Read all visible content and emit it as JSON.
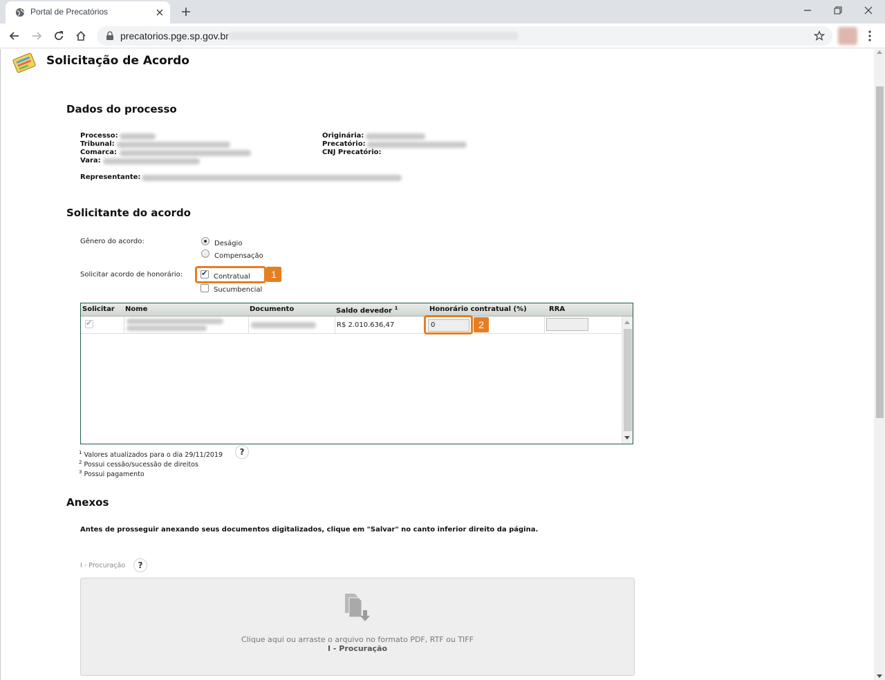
{
  "browser": {
    "tab_title": "Portal de Precatórios",
    "url": "precatorios.pge.sp.gov.br"
  },
  "page": {
    "title": "Solicitação de Acordo"
  },
  "process": {
    "heading": "Dados do processo",
    "labels": {
      "processo": "Processo:",
      "tribunal": "Tribunal:",
      "comarca": "Comarca:",
      "vara": "Vara:",
      "representante": "Representante:",
      "originaria": "Originária:",
      "precatorio": "Precatório:",
      "cnj": "CNJ Precatório:"
    }
  },
  "requester": {
    "heading": "Solicitante do acordo",
    "genero_label": "Gênero do acordo:",
    "genero_options": [
      "Deságio",
      "Compensação"
    ],
    "genero_selected": "Deságio",
    "honorario_label": "Solicitar acordo de honorário:",
    "honorario_options": [
      "Contratual",
      "Sucumbencial"
    ]
  },
  "callouts": [
    "1",
    "2"
  ],
  "table": {
    "columns": [
      "Solicitar",
      "Nome",
      "Documento",
      "Saldo devedor",
      "Honorário contratual (%)",
      "RRA"
    ],
    "saldo_sup": "1",
    "rows": [
      {
        "saldo": "R$ 2.010.636,47",
        "honorario": "0",
        "rra": ""
      }
    ]
  },
  "footnotes": [
    {
      "sup": "1",
      "text": "Valores atualizados para o dia 29/11/2019"
    },
    {
      "sup": "2",
      "text": "Possui cessão/sucessão de direitos"
    },
    {
      "sup": "3",
      "text": "Possui pagamento"
    }
  ],
  "help_label": "?",
  "attachments": {
    "heading": "Anexos",
    "instruction": "Antes de prosseguir anexando seus documentos digitalizados, clique em \"Salvar\" no canto inferior direito da página.",
    "item_label": "I - Procuração",
    "dropzone_text": "Clique aqui ou arraste o arquivo no formato PDF, RTF ou TIFF",
    "dropzone_title": "I - Procuração"
  }
}
